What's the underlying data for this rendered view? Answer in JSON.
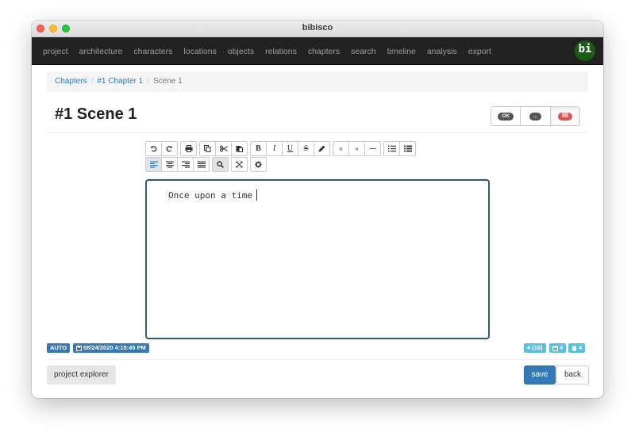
{
  "window": {
    "title": "bibisco"
  },
  "navbar": {
    "items": [
      "project",
      "architecture",
      "characters",
      "locations",
      "objects",
      "relations",
      "chapters",
      "search",
      "timeline",
      "analysis",
      "export"
    ],
    "logo": "bi"
  },
  "breadcrumb": {
    "items": [
      "Chapters",
      "#1 Chapter 1"
    ],
    "active": "Scene 1"
  },
  "page": {
    "title": "#1 Scene 1"
  },
  "status": {
    "ok_label": "OK",
    "progress_label": "...",
    "todo_icon": "list-icon"
  },
  "toolbar": {
    "row1": [
      [
        "undo-icon",
        "redo-icon"
      ],
      [
        "print-icon"
      ],
      [
        "copy-icon",
        "cut-icon",
        "paste-icon"
      ],
      [
        "bold-icon",
        "italic-icon",
        "underline-icon",
        "strikethrough-icon",
        "highlight-icon"
      ],
      [
        "open-quote-icon",
        "close-quote-icon",
        "dash-icon"
      ],
      [
        "ordered-list-icon",
        "unordered-list-icon"
      ]
    ],
    "row2": [
      [
        "align-left-icon",
        "align-center-icon",
        "align-right-icon",
        "align-justify-icon"
      ],
      [
        "search-icon"
      ],
      [
        "fullscreen-icon"
      ],
      [
        "settings-icon"
      ]
    ],
    "glyphs": {
      "bold": "B",
      "italic": "I",
      "underline": "U",
      "strikethrough": "S",
      "open_quote": "«",
      "close_quote": "»",
      "dash": "—"
    }
  },
  "editor": {
    "content": "Once upon a time"
  },
  "footer": {
    "autosave": "AUTO",
    "saved_at": "08/24/2020 4:15:45 PM",
    "words": "4 (16)",
    "characters": "4",
    "pages": "4"
  },
  "buttons": {
    "project_explorer": "project explorer",
    "save": "save",
    "back": "back"
  }
}
